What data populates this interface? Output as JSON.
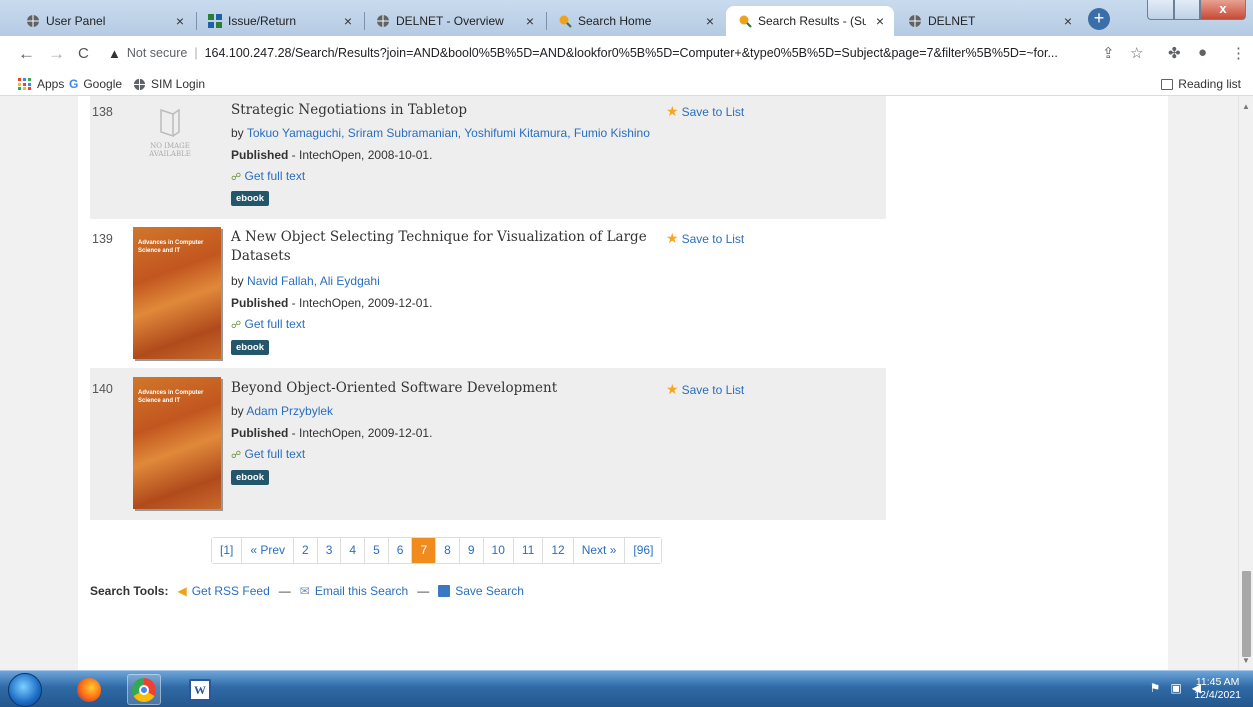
{
  "tabs": [
    {
      "title": "User Panel",
      "icon": "globe-icon"
    },
    {
      "title": "Issue/Return",
      "icon": "grid-icon"
    },
    {
      "title": "DELNET - Overview",
      "icon": "globe-icon"
    },
    {
      "title": "Search Home",
      "icon": "search-icon"
    },
    {
      "title": "Search Results - (Subject",
      "icon": "search-icon",
      "active": true
    },
    {
      "title": "DELNET",
      "icon": "globe-icon"
    }
  ],
  "tab_close": "×",
  "new_tab": "+",
  "window_close": "x",
  "nav": {
    "back": "←",
    "forward": "→",
    "reload": "C"
  },
  "omnibox": {
    "security": "Not secure",
    "url": "164.100.247.28/Search/Results?join=AND&bool0%5B%5D=AND&lookfor0%5B%5D=Computer+&type0%5B%5D=Subject&page=7&filter%5B%5D=~for..."
  },
  "bookmarks": {
    "apps": "Apps",
    "items": [
      "Google",
      "SIM Login"
    ],
    "reading_list": "Reading list"
  },
  "results": [
    {
      "num": "138",
      "title": "Strategic Negotiations in Tabletop",
      "by": "by",
      "authors": "Tokuo Yamaguchi, Sriram Subramanian, Yoshifumi Kitamura, Fumio Kishino",
      "published_label": "Published",
      "published": " - IntechOpen, 2008-10-01.",
      "fulltext": "Get full text",
      "format": "ebook",
      "no_image_1": "NO IMAGE",
      "no_image_2": "AVAILABLE"
    },
    {
      "num": "139",
      "title": "A New Object Selecting Technique for Visualization of Large Datasets",
      "by": "by",
      "authors": "Navid Fallah, Ali Eydgahi",
      "published_label": "Published",
      "published": " - IntechOpen, 2009-12-01.",
      "fulltext": "Get full text",
      "format": "ebook",
      "cover_text": "Advances in Computer Science and IT"
    },
    {
      "num": "140",
      "title": "Beyond Object-Oriented Software Development",
      "by": "by",
      "authors": "Adam Przybylek",
      "published_label": "Published",
      "published": " - IntechOpen, 2009-12-01.",
      "fulltext": "Get full text",
      "format": "ebook",
      "cover_text": "Advances in Computer Science and IT"
    }
  ],
  "save_to_list": "Save to List",
  "pagination": {
    "first": "[1]",
    "prev": "« Prev",
    "pages": [
      "2",
      "3",
      "4",
      "5",
      "6",
      "7",
      "8",
      "9",
      "10",
      "11",
      "12"
    ],
    "current": "7",
    "next": "Next »",
    "last": "[96]"
  },
  "search_tools": {
    "label": "Search Tools:",
    "rss": "Get RSS Feed",
    "sep": "—",
    "email": "Email this Search",
    "save": "Save Search"
  },
  "taskbar": {
    "time": "11:45 AM",
    "date": "12/4/2021"
  },
  "colors": {
    "accent_orange": "#f28b1e",
    "link_blue": "#2a6ebf",
    "badge": "#24566b"
  }
}
